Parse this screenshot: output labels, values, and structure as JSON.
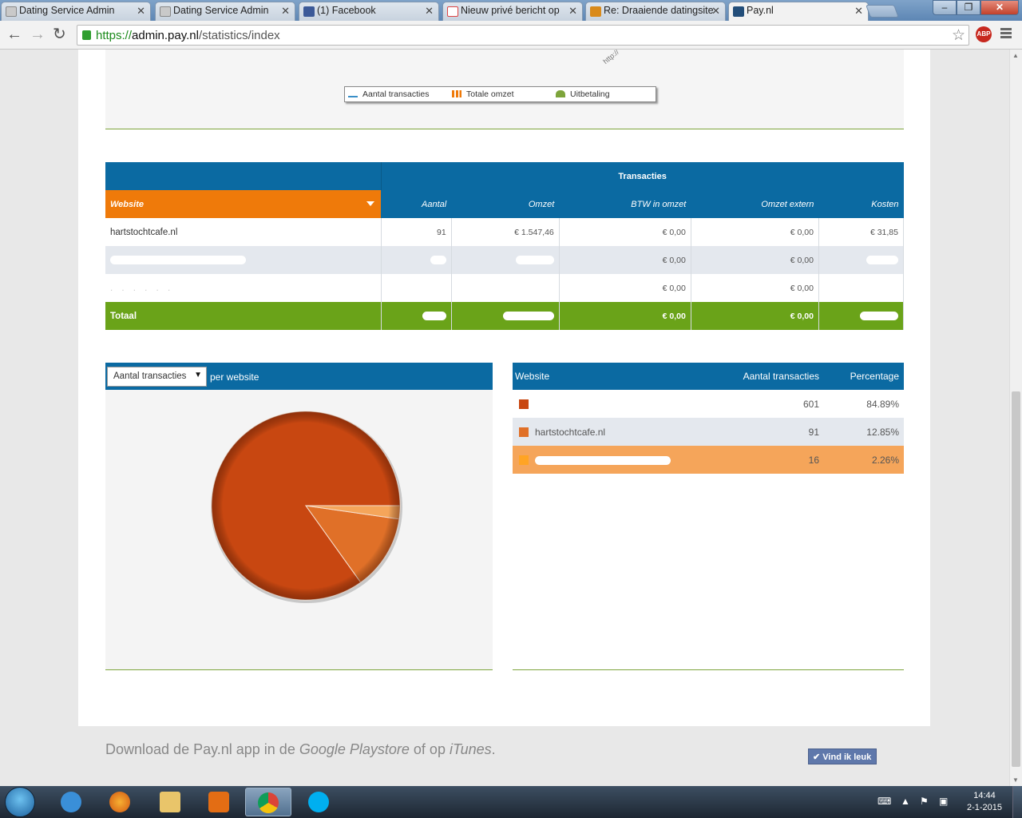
{
  "browser": {
    "tabs": [
      {
        "label": "Dating Service Admin",
        "icon": "mail-icon",
        "active": false
      },
      {
        "label": "Dating Service Admin",
        "icon": "mail-icon",
        "active": false
      },
      {
        "label": "(1) Facebook",
        "icon": "facebook-icon",
        "active": false
      },
      {
        "label": "Nieuw privé bericht op",
        "icon": "gmail-icon",
        "active": false
      },
      {
        "label": "Re: Draaiende datingsite",
        "icon": "forum-icon",
        "active": false
      },
      {
        "label": "Pay.nl",
        "icon": "paynl-icon",
        "active": true
      }
    ],
    "url_scheme": "https://",
    "url_host": "admin.pay.nl",
    "url_path": "/statistics/index",
    "abp_label": "ABP"
  },
  "chart_top": {
    "rotated_labels": [
      "http://"
    ],
    "legend": [
      {
        "label": "Aantal transacties",
        "color": "#3a8fc8",
        "icon": "line-marker-icon"
      },
      {
        "label": "Totale omzet",
        "color": "#ef7a0a",
        "icon": "bar-icon"
      },
      {
        "label": "Uitbetaling",
        "color": "#7da43b",
        "icon": "area-icon"
      }
    ]
  },
  "transactions_table": {
    "group_header": "Transacties",
    "website_header": "Website",
    "columns": [
      "Aantal",
      "Omzet",
      "BTW in omzet",
      "Omzet extern",
      "Kosten"
    ],
    "rows": [
      {
        "site": "hartstochtcafe.nl",
        "aantal": "91",
        "omzet": "€ 1.547,46",
        "btw": "€ 0,00",
        "extern": "€ 0,00",
        "kosten": "€ 31,85"
      },
      {
        "site": "",
        "aantal": "",
        "omzet": "",
        "btw": "€ 0,00",
        "extern": "€ 0,00",
        "kosten": ""
      },
      {
        "site": "",
        "aantal": "",
        "omzet": "",
        "btw": "€ 0,00",
        "extern": "€ 0,00",
        "kosten": ""
      }
    ],
    "total": {
      "label": "Totaal",
      "aantal": "",
      "omzet": "",
      "btw": "€ 0,00",
      "extern": "€ 0,00",
      "kosten": ""
    }
  },
  "pie_panel": {
    "select_value": "Aantal transacties",
    "per_label": "per website"
  },
  "chart_data": {
    "type": "pie",
    "slices": [
      {
        "label": "",
        "value": 601,
        "percent": 84.89,
        "color": "#c84711"
      },
      {
        "label": "hartstochtcafe.nl",
        "value": 91,
        "percent": 12.85,
        "color": "#e07028"
      },
      {
        "label": "",
        "value": 16,
        "percent": 2.26,
        "color": "#f5a55a"
      }
    ]
  },
  "share_table": {
    "headers": [
      "Website",
      "Aantal transacties",
      "Percentage"
    ],
    "rows": [
      {
        "site": "",
        "count": "601",
        "pct": "84.89%",
        "color": "#c84711"
      },
      {
        "site": "hartstochtcafe.nl",
        "count": "91",
        "pct": "12.85%",
        "color": "#e07028"
      },
      {
        "site": "",
        "count": "16",
        "pct": "2.26%",
        "color": "#f5a55a"
      }
    ]
  },
  "footer": {
    "text_a": "Download de Pay.nl app in de ",
    "text_b": "Google Playstore",
    "text_c": " of op ",
    "text_d": "iTunes",
    "text_e": ".",
    "like_label": "Vind ik leuk"
  },
  "taskbar": {
    "time": "14:44",
    "date": "2-1-2015"
  }
}
